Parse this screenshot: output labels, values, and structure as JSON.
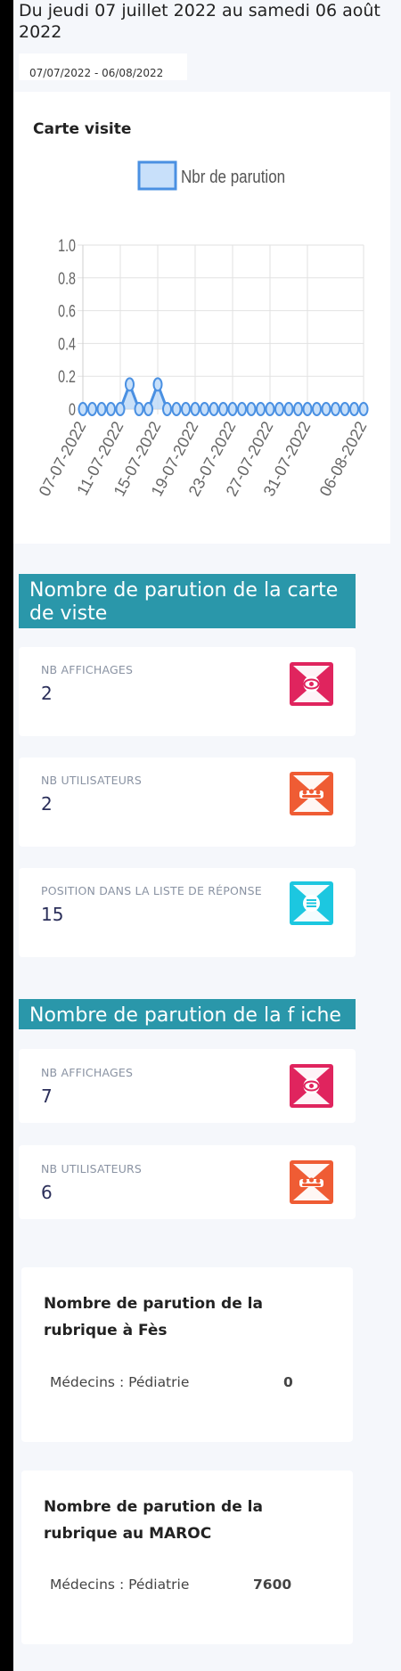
{
  "header": {
    "period_title": "Du jeudi 07 juillet 2022 au samedi 06 août 2022",
    "date_range": "07/07/2022 - 06/08/2022"
  },
  "chart_card": {
    "title": "Carte visite"
  },
  "chart_data": {
    "type": "line",
    "title": "",
    "legend": {
      "position": "top"
    },
    "series": [
      {
        "name": "Nbr de parution",
        "color": "#4a90e2",
        "fill": "#bcd8f7",
        "values": [
          0,
          0,
          0,
          0,
          0,
          0.15,
          0,
          0,
          0.15,
          0,
          0,
          0,
          0,
          0,
          0,
          0,
          0,
          0,
          0,
          0,
          0,
          0,
          0,
          0,
          0,
          0,
          0,
          0,
          0,
          0,
          0
        ]
      }
    ],
    "x": [
      "07-07-2022",
      "08-07-2022",
      "09-07-2022",
      "10-07-2022",
      "11-07-2022",
      "12-07-2022",
      "13-07-2022",
      "14-07-2022",
      "15-07-2022",
      "16-07-2022",
      "17-07-2022",
      "18-07-2022",
      "19-07-2022",
      "20-07-2022",
      "21-07-2022",
      "22-07-2022",
      "23-07-2022",
      "24-07-2022",
      "25-07-2022",
      "26-07-2022",
      "27-07-2022",
      "28-07-2022",
      "29-07-2022",
      "30-07-2022",
      "31-07-2022",
      "01-08-2022",
      "02-08-2022",
      "03-08-2022",
      "04-08-2022",
      "05-08-2022",
      "06-08-2022"
    ],
    "x_tick_labels": [
      "07-07-2022",
      "11-07-2022",
      "15-07-2022",
      "19-07-2022",
      "23-07-2022",
      "27-07-2022",
      "31-07-2022",
      "06-08-2022"
    ],
    "y_ticks": [
      "0",
      "0.2",
      "0.4",
      "0.6",
      "0.8",
      "1.0"
    ],
    "ylim": [
      0,
      1.0
    ],
    "grid": true
  },
  "sections": [
    {
      "title": "Nombre de parution de la carte de viste",
      "stats": [
        {
          "label": "NB AFFICHAGES",
          "value": "2",
          "icon": "eye-icon",
          "color": "#e0245e"
        },
        {
          "label": "NB UTILISATEURS",
          "value": "2",
          "icon": "users-icon",
          "color": "#ef5c34"
        },
        {
          "label": "POSITION DANS LA LISTE DE RÉPONSE",
          "value": "15",
          "icon": "list-icon",
          "color": "#1cc7e0"
        }
      ]
    },
    {
      "title": "Nombre de parution de la f iche",
      "stats": [
        {
          "label": "NB AFFICHAGES",
          "value": "7",
          "icon": "eye-icon",
          "color": "#e0245e"
        },
        {
          "label": "NB UTILISATEURS",
          "value": "6",
          "icon": "users-icon",
          "color": "#ef5c34"
        }
      ]
    }
  ],
  "rubrics": [
    {
      "title": "Nombre de parution de la rubrique à Fès",
      "row_label": "Médecins : Pédiatrie",
      "row_value": "0"
    },
    {
      "title": "Nombre de parution de la rubrique au MAROC",
      "row_label": "Médecins : Pédiatrie",
      "row_value": "7600"
    }
  ]
}
